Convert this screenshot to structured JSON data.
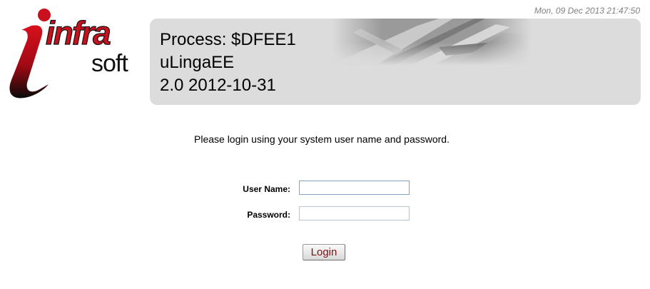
{
  "header": {
    "timestamp": "Mon, 09 Dec 2013 21:47:50",
    "logo": {
      "text_primary": "infra",
      "text_secondary": "soft"
    }
  },
  "banner": {
    "line1": "Process: $DFEE1",
    "line2": "uLingaEE",
    "line3": "2.0 2012-10-31"
  },
  "login": {
    "instructions": "Please login using your system user name and password.",
    "username_label": "User Name:",
    "username_value": "",
    "password_label": "Password:",
    "password_value": "",
    "submit_label": "Login"
  },
  "colors": {
    "logo_red": "#c8101e",
    "banner_bg": "#dcdcdc",
    "button_text": "#7a1010",
    "timestamp_text": "#808080"
  }
}
